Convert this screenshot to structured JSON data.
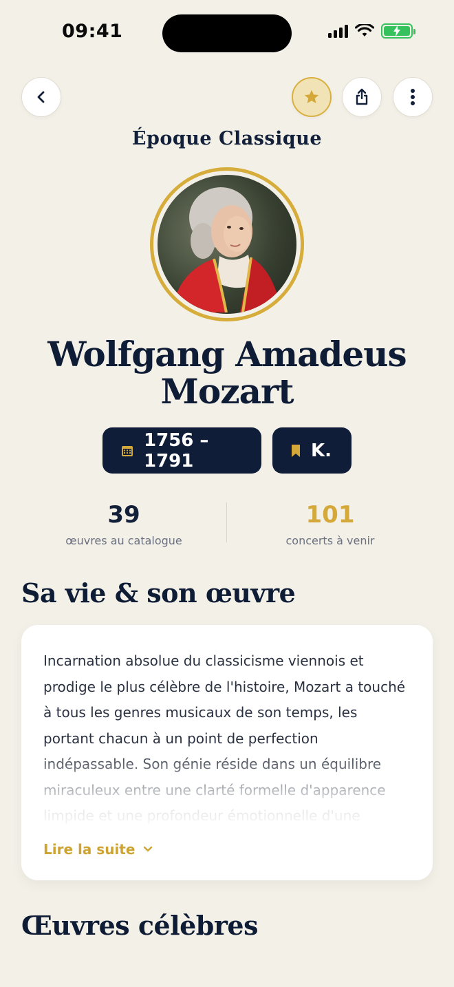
{
  "status_bar": {
    "time": "09:41"
  },
  "header": {
    "era": "Époque Classique"
  },
  "composer": {
    "name_line1": "Wolfgang Amadeus",
    "name_line2": "Mozart",
    "dates": "1756 – 1791",
    "catalog": "K."
  },
  "stats": [
    {
      "value": "39",
      "label": "œuvres au catalogue",
      "color": "#12203a"
    },
    {
      "value": "101",
      "label": "concerts à venir",
      "color": "#d4a93a"
    }
  ],
  "bio_section": {
    "title": "Sa vie & son œuvre",
    "text": "Incarnation absolue du classicisme viennois et prodige le plus célèbre de l'histoire, Mozart a touché à tous les genres musicaux de son temps, les portant chacun à un point de perfection indépassable. Son génie réside dans un équilibre miraculeux entre une clarté formelle d'apparence limpide et une profondeur émotionnelle d'une",
    "read_more": "Lire la suite"
  },
  "works_section": {
    "title": "Œuvres célèbres"
  },
  "icons": {
    "back": "chevron-left-icon",
    "favorite": "star-icon",
    "share": "share-icon",
    "more": "more-vertical-icon",
    "dates": "calendar-icon",
    "catalog": "bookmark-icon",
    "read_more": "chevron-down-icon"
  },
  "colors": {
    "accent": "#d4a93a",
    "navy": "#0f1d38",
    "background": "#f3f0e8"
  }
}
